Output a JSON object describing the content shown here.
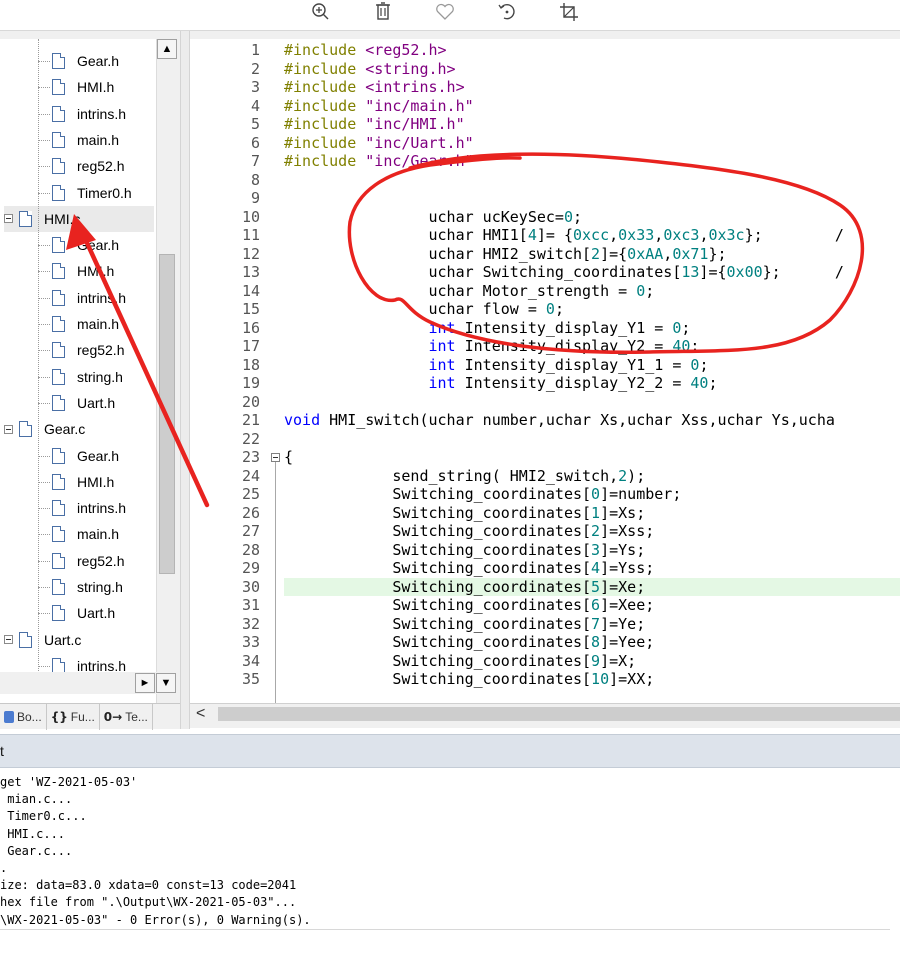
{
  "viewer_toolbar": {
    "icons": [
      "zoom-in-icon",
      "trash-icon",
      "heart-icon",
      "rotate-icon",
      "crop-icon"
    ]
  },
  "project_tree": {
    "items": [
      {
        "label": "Gear.h",
        "kind": "file"
      },
      {
        "label": "HMI.h",
        "kind": "file"
      },
      {
        "label": "intrins.h",
        "kind": "file"
      },
      {
        "label": "main.h",
        "kind": "file"
      },
      {
        "label": "reg52.h",
        "kind": "file"
      },
      {
        "label": "Timer0.h",
        "kind": "file"
      },
      {
        "label": "HMI.c",
        "kind": "group"
      },
      {
        "label": "Gear.h",
        "kind": "file"
      },
      {
        "label": "HMI.h",
        "kind": "file"
      },
      {
        "label": "intrins.h",
        "kind": "file"
      },
      {
        "label": "main.h",
        "kind": "file"
      },
      {
        "label": "reg52.h",
        "kind": "file"
      },
      {
        "label": "string.h",
        "kind": "file"
      },
      {
        "label": "Uart.h",
        "kind": "file"
      },
      {
        "label": "Gear.c",
        "kind": "group"
      },
      {
        "label": "Gear.h",
        "kind": "file"
      },
      {
        "label": "HMI.h",
        "kind": "file"
      },
      {
        "label": "intrins.h",
        "kind": "file"
      },
      {
        "label": "main.h",
        "kind": "file"
      },
      {
        "label": "reg52.h",
        "kind": "file"
      },
      {
        "label": "string.h",
        "kind": "file"
      },
      {
        "label": "Uart.h",
        "kind": "file"
      },
      {
        "label": "Uart.c",
        "kind": "group"
      },
      {
        "label": "intrins.h",
        "kind": "file"
      }
    ],
    "selected": "HMI.c"
  },
  "pane_tabs": [
    {
      "icon": "books-icon",
      "glyph": "",
      "label": "Bo..."
    },
    {
      "icon": "functions-icon",
      "glyph": "{}",
      "label": "Fu..."
    },
    {
      "icon": "templates-icon",
      "glyph": "0→",
      "label": "Te..."
    }
  ],
  "editor": {
    "highlighted_line": 30,
    "lines": [
      {
        "n": "1",
        "segs": [
          {
            "t": "#include ",
            "c": "#808000"
          },
          {
            "t": "<reg52.h>",
            "c": "#800080"
          }
        ]
      },
      {
        "n": "2",
        "segs": [
          {
            "t": "#include ",
            "c": "#808000"
          },
          {
            "t": "<string.h>",
            "c": "#800080"
          }
        ]
      },
      {
        "n": "3",
        "segs": [
          {
            "t": "#include ",
            "c": "#808000"
          },
          {
            "t": "<intrins.h>",
            "c": "#800080"
          }
        ]
      },
      {
        "n": "4",
        "segs": [
          {
            "t": "#include ",
            "c": "#808000"
          },
          {
            "t": "\"inc/main.h\"",
            "c": "#800080"
          }
        ]
      },
      {
        "n": "5",
        "segs": [
          {
            "t": "#include ",
            "c": "#808000"
          },
          {
            "t": "\"inc/HMI.h\"",
            "c": "#800080"
          }
        ]
      },
      {
        "n": "6",
        "segs": [
          {
            "t": "#include ",
            "c": "#808000"
          },
          {
            "t": "\"inc/Uart.h\"",
            "c": "#800080"
          }
        ]
      },
      {
        "n": "7",
        "segs": [
          {
            "t": "#include ",
            "c": "#808000"
          },
          {
            "t": "\"inc/Gear.h\"",
            "c": "#800080"
          }
        ]
      },
      {
        "n": "8",
        "segs": []
      },
      {
        "n": "9",
        "segs": []
      },
      {
        "n": "10",
        "segs": [
          {
            "t": "                uchar ucKeySec=",
            "c": "#000000"
          },
          {
            "t": "0",
            "c": "#008080"
          },
          {
            "t": ";",
            "c": "#000000"
          }
        ]
      },
      {
        "n": "11",
        "segs": [
          {
            "t": "                uchar HMI1[",
            "c": "#000000"
          },
          {
            "t": "4",
            "c": "#008080"
          },
          {
            "t": "]= {",
            "c": "#000000"
          },
          {
            "t": "0xcc",
            "c": "#008080"
          },
          {
            "t": ",",
            "c": "#000000"
          },
          {
            "t": "0x33",
            "c": "#008080"
          },
          {
            "t": ",",
            "c": "#000000"
          },
          {
            "t": "0xc3",
            "c": "#008080"
          },
          {
            "t": ",",
            "c": "#000000"
          },
          {
            "t": "0x3c",
            "c": "#008080"
          },
          {
            "t": "};        /",
            "c": "#000000"
          }
        ]
      },
      {
        "n": "12",
        "segs": [
          {
            "t": "                uchar HMI2_switch[",
            "c": "#000000"
          },
          {
            "t": "2",
            "c": "#008080"
          },
          {
            "t": "]={",
            "c": "#000000"
          },
          {
            "t": "0xAA",
            "c": "#008080"
          },
          {
            "t": ",",
            "c": "#000000"
          },
          {
            "t": "0x71",
            "c": "#008080"
          },
          {
            "t": "};",
            "c": "#000000"
          }
        ]
      },
      {
        "n": "13",
        "segs": [
          {
            "t": "                uchar Switching_coordinates[",
            "c": "#000000"
          },
          {
            "t": "13",
            "c": "#008080"
          },
          {
            "t": "]={",
            "c": "#000000"
          },
          {
            "t": "0x00",
            "c": "#008080"
          },
          {
            "t": "};      /",
            "c": "#000000"
          }
        ]
      },
      {
        "n": "14",
        "segs": [
          {
            "t": "                uchar Motor_strength = ",
            "c": "#000000"
          },
          {
            "t": "0",
            "c": "#008080"
          },
          {
            "t": ";",
            "c": "#000000"
          }
        ]
      },
      {
        "n": "15",
        "segs": [
          {
            "t": "                uchar flow = ",
            "c": "#000000"
          },
          {
            "t": "0",
            "c": "#008080"
          },
          {
            "t": ";",
            "c": "#000000"
          }
        ]
      },
      {
        "n": "16",
        "segs": [
          {
            "t": "                ",
            "c": "#000000"
          },
          {
            "t": "int",
            "c": "#0000ff"
          },
          {
            "t": " Intensity_display_Y1 = ",
            "c": "#000000"
          },
          {
            "t": "0",
            "c": "#008080"
          },
          {
            "t": ";",
            "c": "#000000"
          }
        ]
      },
      {
        "n": "17",
        "segs": [
          {
            "t": "                ",
            "c": "#000000"
          },
          {
            "t": "int",
            "c": "#0000ff"
          },
          {
            "t": " Intensity_display_Y2 = ",
            "c": "#000000"
          },
          {
            "t": "40",
            "c": "#008080"
          },
          {
            "t": ";",
            "c": "#000000"
          }
        ]
      },
      {
        "n": "18",
        "segs": [
          {
            "t": "                ",
            "c": "#000000"
          },
          {
            "t": "int",
            "c": "#0000ff"
          },
          {
            "t": " Intensity_display_Y1_1 = ",
            "c": "#000000"
          },
          {
            "t": "0",
            "c": "#008080"
          },
          {
            "t": ";",
            "c": "#000000"
          }
        ]
      },
      {
        "n": "19",
        "segs": [
          {
            "t": "                ",
            "c": "#000000"
          },
          {
            "t": "int",
            "c": "#0000ff"
          },
          {
            "t": " Intensity_display_Y2_2 = ",
            "c": "#000000"
          },
          {
            "t": "40",
            "c": "#008080"
          },
          {
            "t": ";",
            "c": "#000000"
          }
        ]
      },
      {
        "n": "20",
        "segs": []
      },
      {
        "n": "21",
        "segs": [
          {
            "t": "void",
            "c": "#0000ff"
          },
          {
            "t": " HMI_switch(uchar number,uchar Xs,uchar Xss,uchar Ys,ucha",
            "c": "#000000"
          }
        ]
      },
      {
        "n": "22",
        "segs": []
      },
      {
        "n": "23",
        "segs": [
          {
            "t": "{",
            "c": "#000000"
          }
        ]
      },
      {
        "n": "24",
        "segs": [
          {
            "t": "            send_string( HMI2_switch,",
            "c": "#000000"
          },
          {
            "t": "2",
            "c": "#008080"
          },
          {
            "t": ");",
            "c": "#000000"
          }
        ]
      },
      {
        "n": "25",
        "segs": [
          {
            "t": "            Switching_coordinates[",
            "c": "#000000"
          },
          {
            "t": "0",
            "c": "#008080"
          },
          {
            "t": "]=number;",
            "c": "#000000"
          }
        ]
      },
      {
        "n": "26",
        "segs": [
          {
            "t": "            Switching_coordinates[",
            "c": "#000000"
          },
          {
            "t": "1",
            "c": "#008080"
          },
          {
            "t": "]=Xs;",
            "c": "#000000"
          }
        ]
      },
      {
        "n": "27",
        "segs": [
          {
            "t": "            Switching_coordinates[",
            "c": "#000000"
          },
          {
            "t": "2",
            "c": "#008080"
          },
          {
            "t": "]=Xss;",
            "c": "#000000"
          }
        ]
      },
      {
        "n": "28",
        "segs": [
          {
            "t": "            Switching_coordinates[",
            "c": "#000000"
          },
          {
            "t": "3",
            "c": "#008080"
          },
          {
            "t": "]=Ys;",
            "c": "#000000"
          }
        ]
      },
      {
        "n": "29",
        "segs": [
          {
            "t": "            Switching_coordinates[",
            "c": "#000000"
          },
          {
            "t": "4",
            "c": "#008080"
          },
          {
            "t": "]=Yss;",
            "c": "#000000"
          }
        ]
      },
      {
        "n": "30",
        "segs": [
          {
            "t": "            Switching_coordinates[",
            "c": "#000000"
          },
          {
            "t": "5",
            "c": "#008080"
          },
          {
            "t": "]=Xe;",
            "c": "#000000"
          }
        ]
      },
      {
        "n": "31",
        "segs": [
          {
            "t": "            Switching_coordinates[",
            "c": "#000000"
          },
          {
            "t": "6",
            "c": "#008080"
          },
          {
            "t": "]=Xee;",
            "c": "#000000"
          }
        ]
      },
      {
        "n": "32",
        "segs": [
          {
            "t": "            Switching_coordinates[",
            "c": "#000000"
          },
          {
            "t": "7",
            "c": "#008080"
          },
          {
            "t": "]=Ye;",
            "c": "#000000"
          }
        ]
      },
      {
        "n": "33",
        "segs": [
          {
            "t": "            Switching_coordinates[",
            "c": "#000000"
          },
          {
            "t": "8",
            "c": "#008080"
          },
          {
            "t": "]=Yee;",
            "c": "#000000"
          }
        ]
      },
      {
        "n": "34",
        "segs": [
          {
            "t": "            Switching_coordinates[",
            "c": "#000000"
          },
          {
            "t": "9",
            "c": "#008080"
          },
          {
            "t": "]=X;",
            "c": "#000000"
          }
        ]
      },
      {
        "n": "35",
        "segs": [
          {
            "t": "            Switching_coordinates[",
            "c": "#000000"
          },
          {
            "t": "10",
            "c": "#008080"
          },
          {
            "t": "]=XX;",
            "c": "#000000"
          }
        ]
      }
    ]
  },
  "build_output": {
    "title": "t",
    "lines": [
      "get 'WZ-2021-05-03'",
      " mian.c...",
      " Timer0.c...",
      " HMI.c...",
      " Gear.c...",
      ".",
      "ize: data=83.0 xdata=0 const=13 code=2041",
      "hex file from \".\\Output\\WX-2021-05-03\"...",
      "\\WX-2021-05-03\" - 0 Error(s), 0 Warning(s)."
    ]
  },
  "colors": {
    "annotation_red": "#e8231f",
    "highlight_line": "#e4f8e4",
    "output_header": "#dde3eb"
  }
}
